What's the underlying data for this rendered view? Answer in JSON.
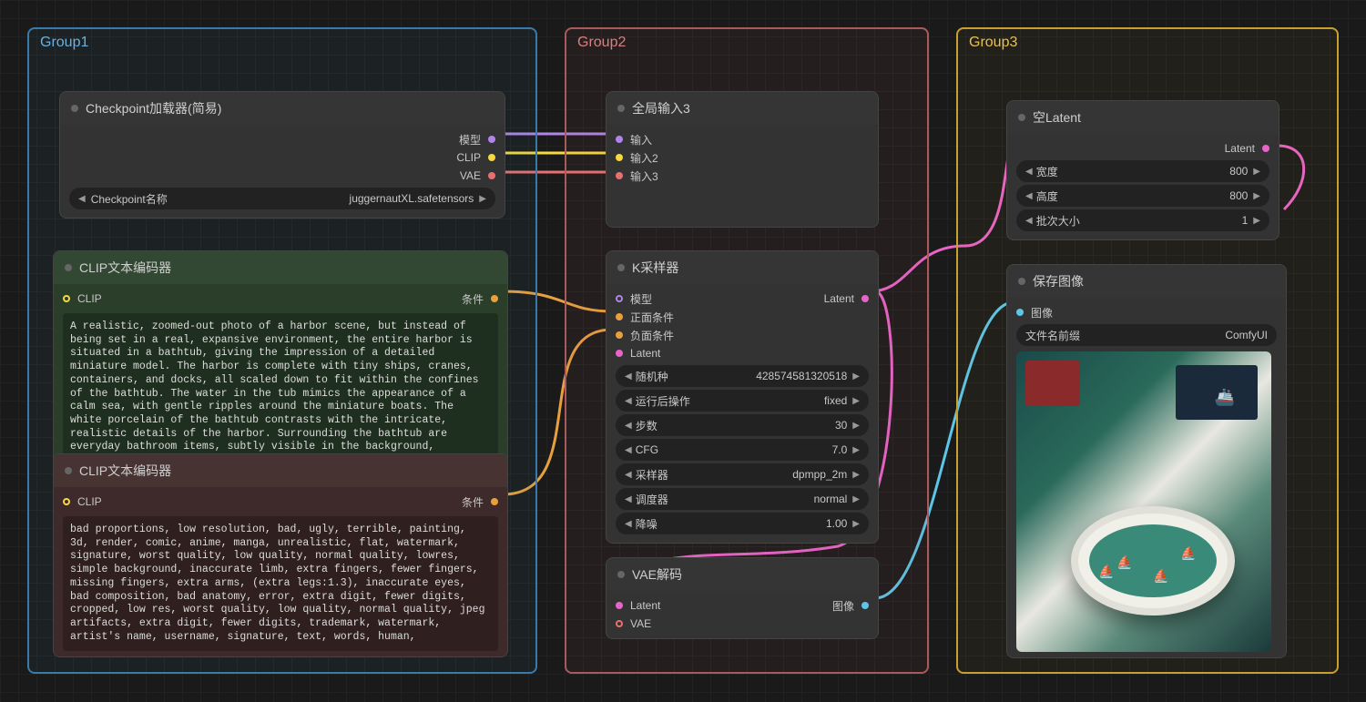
{
  "groups": {
    "g1": {
      "title": "Group1",
      "color": "#3a7aaa"
    },
    "g2": {
      "title": "Group2",
      "color": "#aa5a5a"
    },
    "g3": {
      "title": "Group3",
      "color": "#c8a030"
    }
  },
  "checkpoint": {
    "title": "Checkpoint加载器(简易)",
    "out_model": "模型",
    "out_clip": "CLIP",
    "out_vae": "VAE",
    "widget_label": "Checkpoint名称",
    "widget_value": "juggernautXL.safetensors"
  },
  "clip_pos": {
    "title": "CLIP文本编码器",
    "in_clip": "CLIP",
    "out_cond": "条件",
    "text": "A realistic, zoomed-out photo of a harbor scene, but instead of being set in a real, expansive environment, the entire harbor is situated in a bathtub, giving the impression of a detailed miniature model. The harbor is complete with tiny ships, cranes, containers, and docks, all scaled down to fit within the confines of the bathtub. The water in the tub mimics the appearance of a calm sea, with gentle ripples around the miniature boats. The white porcelain of the bathtub contrasts with the intricate, realistic details of the harbor. Surrounding the bathtub are everyday bathroom items, subtly visible in the background, reinforcing the surreal setting of this miniature world."
  },
  "clip_neg": {
    "title": "CLIP文本编码器",
    "in_clip": "CLIP",
    "out_cond": "条件",
    "text": "bad proportions, low resolution, bad, ugly, terrible, painting, 3d, render, comic, anime, manga, unrealistic, flat, watermark, signature, worst quality, low quality, normal quality, lowres, simple background, inaccurate limb, extra fingers, fewer fingers, missing fingers, extra arms, (extra legs:1.3), inaccurate eyes, bad composition, bad anatomy, error, extra digit, fewer digits, cropped, low res, worst quality, low quality, normal quality, jpeg artifacts, extra digit, fewer digits, trademark, watermark, artist's name, username, signature, text, words, human,"
  },
  "global_input": {
    "title": "全局输入3",
    "in1": "输入",
    "in2": "输入2",
    "in3": "输入3"
  },
  "ksampler": {
    "title": "K采样器",
    "in_model": "模型",
    "in_pos": "正面条件",
    "in_neg": "负面条件",
    "in_latent": "Latent",
    "out_latent": "Latent",
    "seed_l": "随机种",
    "seed_v": "428574581320518",
    "after_l": "运行后操作",
    "after_v": "fixed",
    "steps_l": "步数",
    "steps_v": "30",
    "cfg_l": "CFG",
    "cfg_v": "7.0",
    "sampler_l": "采样器",
    "sampler_v": "dpmpp_2m",
    "sched_l": "调度器",
    "sched_v": "normal",
    "denoise_l": "降噪",
    "denoise_v": "1.00"
  },
  "vae_decode": {
    "title": "VAE解码",
    "in_latent": "Latent",
    "in_vae": "VAE",
    "out_image": "图像"
  },
  "empty_latent": {
    "title": "空Latent",
    "out_latent": "Latent",
    "w_l": "宽度",
    "w_v": "800",
    "h_l": "高度",
    "h_v": "800",
    "b_l": "批次大小",
    "b_v": "1"
  },
  "save_image": {
    "title": "保存图像",
    "in_image": "图像",
    "prefix_l": "文件名前缀",
    "prefix_v": "ComfyUI"
  }
}
